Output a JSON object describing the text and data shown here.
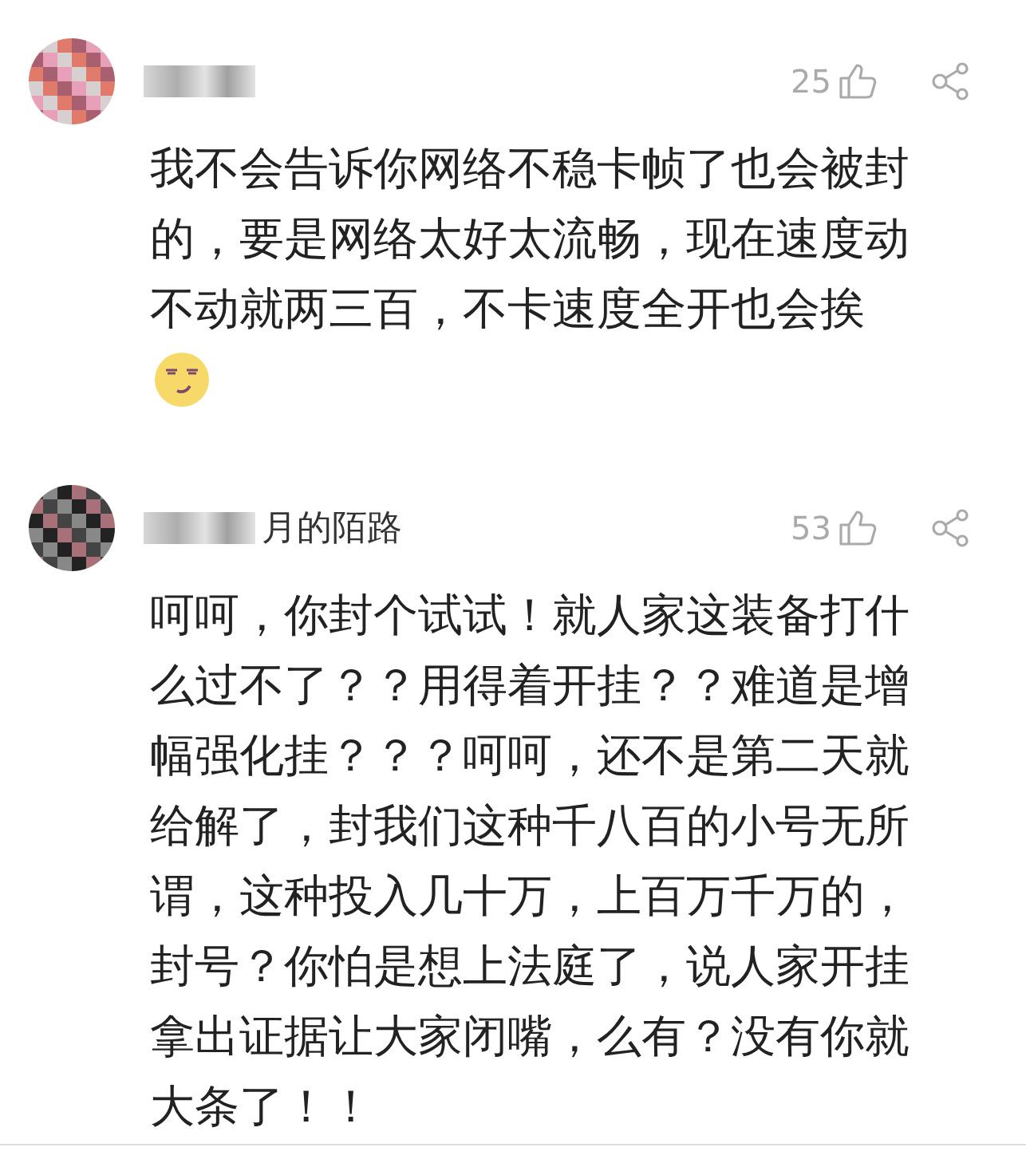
{
  "comments": [
    {
      "likes": "25",
      "text": "我不会告诉你网络不稳卡帧了也会被封的，要是网络太好太流畅，现在速度动不动就两三百，不卡速度全开也会挨",
      "emoji": true
    },
    {
      "name": "月的陌路",
      "likes": "53",
      "text": "呵呵，你封个试试！就人家这装备打什么过不了？？用得着开挂？？难道是增幅强化挂？？？呵呵，还不是第二天就给解了，封我们这种千八百的小号无所谓，这种投入几十万，上百万千万的，封号？你怕是想上法庭了，说人家开挂拿出证据让大家闭嘴，么有？没有你就大条了！！",
      "emoji": false
    }
  ]
}
